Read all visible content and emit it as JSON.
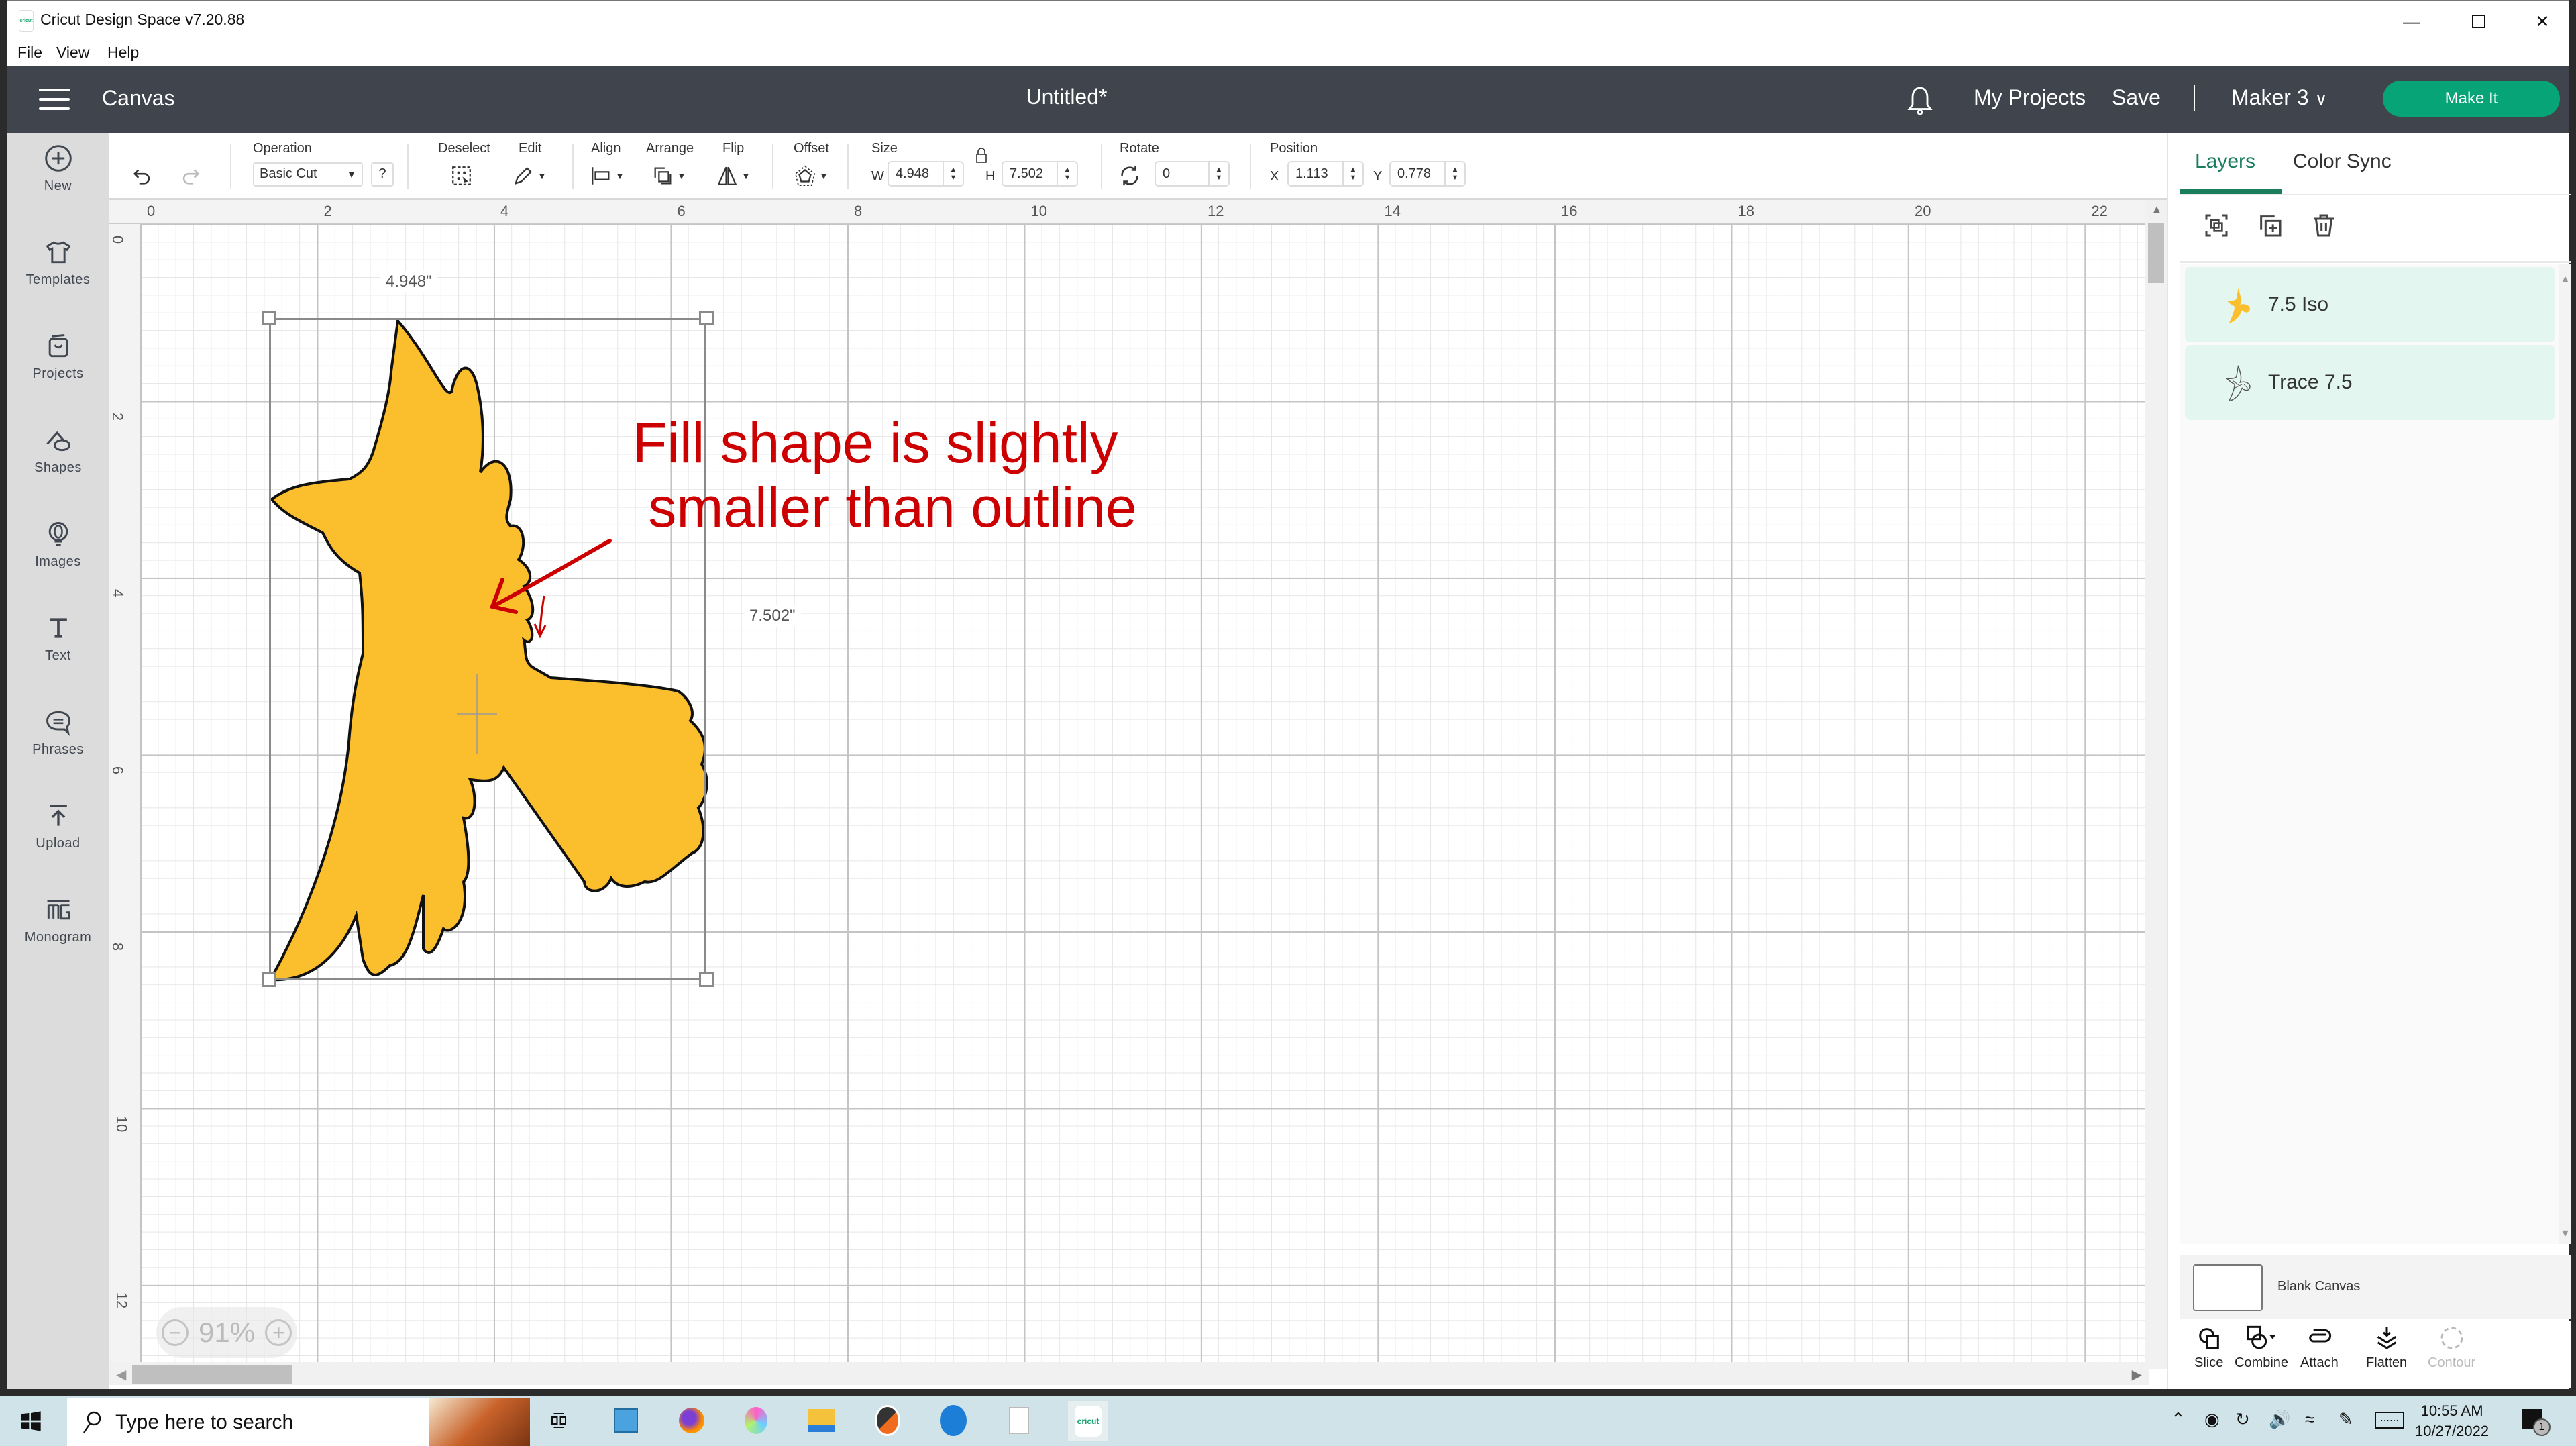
{
  "window": {
    "app_title": "Cricut Design Space  v7.20.88",
    "logo_text": "cricut",
    "controls": {
      "minimize": "minimize-icon",
      "maximize": "maximize-icon",
      "close": "close-icon"
    }
  },
  "menu": [
    "File",
    "View",
    "Help"
  ],
  "header": {
    "section": "Canvas",
    "doc_title": "Untitled*",
    "my_projects": "My Projects",
    "save": "Save",
    "machine": "Maker 3",
    "make_it": "Make It"
  },
  "sidebar": {
    "items": [
      {
        "label": "New",
        "icon": "plus-circle-icon"
      },
      {
        "label": "Templates",
        "icon": "shirt-icon"
      },
      {
        "label": "Projects",
        "icon": "projects-icon"
      },
      {
        "label": "Shapes",
        "icon": "shapes-icon"
      },
      {
        "label": "Images",
        "icon": "lightbulb-icon"
      },
      {
        "label": "Text",
        "icon": "text-icon"
      },
      {
        "label": "Phrases",
        "icon": "speech-bubble-icon"
      },
      {
        "label": "Upload",
        "icon": "upload-icon"
      },
      {
        "label": "Monogram",
        "icon": "monogram-icon"
      }
    ]
  },
  "toolbar": {
    "operation_label": "Operation",
    "operation_value": "Basic Cut",
    "help": "?",
    "deselect": "Deselect",
    "edit": "Edit",
    "align": "Align",
    "arrange": "Arrange",
    "flip": "Flip",
    "offset": "Offset",
    "size": "Size",
    "w_label": "W",
    "w_value": "4.948",
    "h_label": "H",
    "h_value": "7.502",
    "rotate": "Rotate",
    "rotate_value": "0",
    "position": "Position",
    "x_label": "X",
    "x_value": "1.113",
    "y_label": "Y",
    "y_value": "0.778"
  },
  "canvas": {
    "ruler_x": [
      "0",
      "2",
      "4",
      "6",
      "8",
      "10",
      "12",
      "14",
      "16",
      "18",
      "20",
      "22"
    ],
    "ruler_y": [
      "0",
      "2",
      "4",
      "6",
      "8",
      "10",
      "12"
    ],
    "width_label": "4.948\"",
    "height_label": "7.502\"",
    "annotation_line1": "Fill shape is slightly",
    "annotation_line2": " smaller than outline",
    "annotation_color": "#cc0000",
    "fill_color": "#fbbf2e",
    "zoom": "91%"
  },
  "panel": {
    "tabs": [
      "Layers",
      "Color Sync"
    ],
    "active_tab": "Layers",
    "layers": [
      {
        "name": "7.5 Iso",
        "thumb": "yellow-bird-icon"
      },
      {
        "name": "Trace 7.5",
        "thumb": "outline-bird-icon"
      }
    ],
    "blank_canvas": "Blank Canvas",
    "actions": [
      "Slice",
      "Combine",
      "Attach",
      "Flatten",
      "Contour"
    ]
  },
  "taskbar": {
    "search_placeholder": "Type here to search",
    "time": "10:55 AM",
    "date": "10/27/2022",
    "notification_count": "1",
    "cricut_text": "cricut"
  }
}
